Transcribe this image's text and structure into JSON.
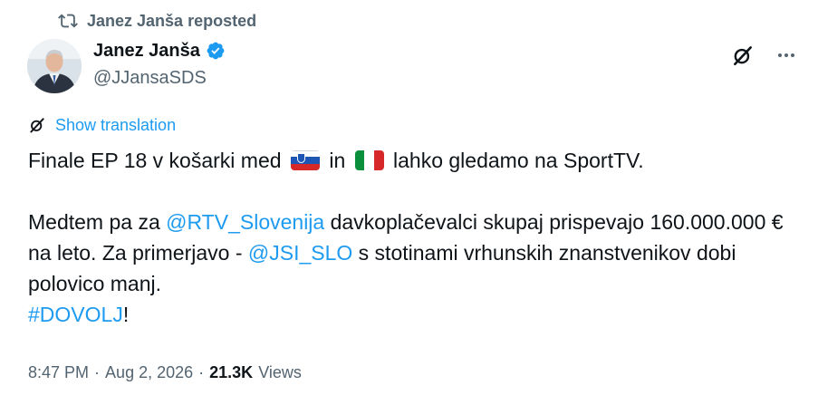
{
  "repost": {
    "label": "Janez Janša reposted",
    "icon": "repost-icon"
  },
  "author": {
    "name": "Janez Janša",
    "handle": "@JJansaSDS",
    "verified_icon": "verified-badge-icon",
    "verified_color": "#1d9bf0"
  },
  "actions": {
    "grok_icon": "grok-icon",
    "more_icon": "more-icon"
  },
  "translation": {
    "label": "Show translation",
    "icon": "grok-icon"
  },
  "tweet": {
    "line1": {
      "a": "Finale EP 18 v košarki med",
      "b": "in",
      "c": "lahko gledamo na SportTV."
    },
    "p2": {
      "t1": "Medtem pa za",
      "mention1": "@RTV_Slovenija",
      "t2": "davkoplačevalci skupaj prispevajo 160.000.000 € na leto. Za primerjavo -",
      "mention2": "@JSI_SLO",
      "t3": "s stotinami vrhunskih znanstvenikov dobi polovico manj."
    },
    "hashtag": "#DOVOLJ",
    "hashtag_suffix": "!"
  },
  "meta": {
    "time": "8:47 PM",
    "sep1": "·",
    "date": "Aug 2, 2026",
    "sep2": "·",
    "views_count": "21.3K",
    "views_label": "Views"
  },
  "colors": {
    "accent": "#1d9bf0",
    "secondary_text": "#536471",
    "primary_text": "#0f1419"
  }
}
